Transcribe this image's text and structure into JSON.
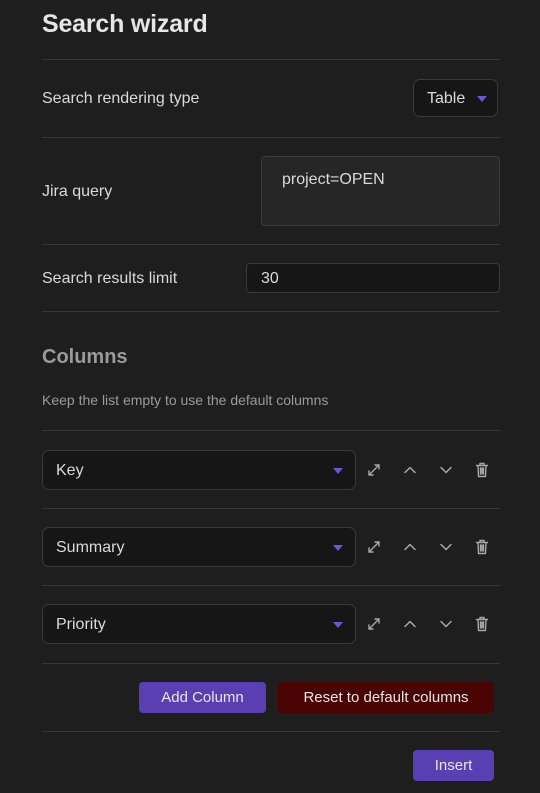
{
  "title": "Search wizard",
  "rendering": {
    "label": "Search rendering type",
    "value": "Table"
  },
  "query": {
    "label": "Jira query",
    "value": "project=OPEN"
  },
  "limit": {
    "label": "Search results limit",
    "value": "30"
  },
  "columns": {
    "title": "Columns",
    "hint": "Keep the list empty to use the default columns",
    "items": [
      {
        "label": "Key"
      },
      {
        "label": "Summary"
      },
      {
        "label": "Priority"
      }
    ]
  },
  "buttons": {
    "add_column": "Add Column",
    "reset": "Reset to default columns",
    "insert": "Insert"
  },
  "colors": {
    "accent": "#5a3fb2",
    "caret": "#6b57d6",
    "danger": "#4a0303",
    "background": "#1e1e1e"
  },
  "icons": [
    "expand-icon",
    "chevron-up-icon",
    "chevron-down-icon",
    "trash-icon"
  ]
}
